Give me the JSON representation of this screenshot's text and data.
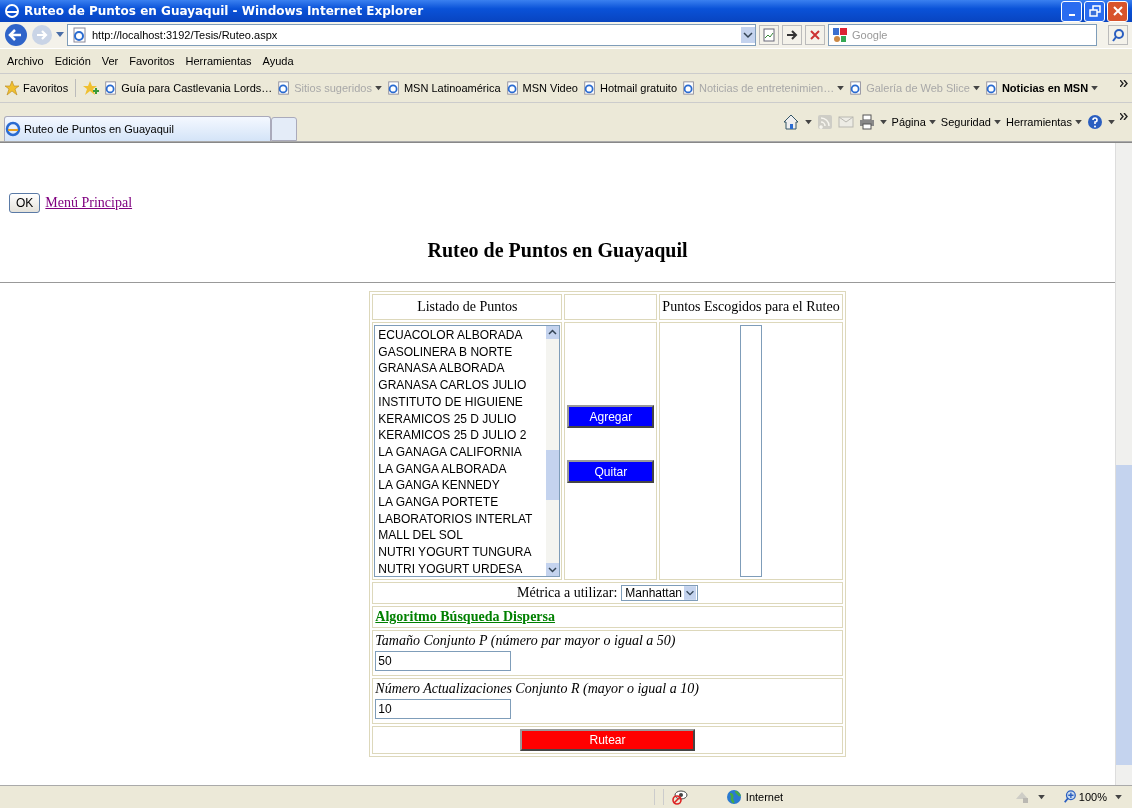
{
  "window": {
    "title": "Ruteo de Puntos en Guayaquil - Windows Internet Explorer"
  },
  "address_bar": {
    "url": "http://localhost:3192/Tesis/Ruteo.aspx"
  },
  "search_field": {
    "placeholder": "Google"
  },
  "menu": [
    "Archivo",
    "Edición",
    "Ver",
    "Favoritos",
    "Herramientas",
    "Ayuda"
  ],
  "favorites_bar": {
    "label": "Favoritos",
    "items": [
      {
        "label": "Guía para Castlevania Lords…",
        "dropdown": false,
        "disabled": false,
        "bold": false
      },
      {
        "label": "Sitios sugeridos",
        "dropdown": true,
        "disabled": true,
        "bold": false
      },
      {
        "label": "MSN Latinoamérica",
        "dropdown": false,
        "disabled": false,
        "bold": false
      },
      {
        "label": "MSN Video",
        "dropdown": false,
        "disabled": false,
        "bold": false
      },
      {
        "label": "Hotmail gratuito",
        "dropdown": false,
        "disabled": false,
        "bold": false
      },
      {
        "label": "Noticias de entretenimien…",
        "dropdown": true,
        "disabled": true,
        "bold": false
      },
      {
        "label": "Galería de Web Slice",
        "dropdown": true,
        "disabled": true,
        "bold": false
      },
      {
        "label": "Noticias en MSN",
        "dropdown": true,
        "disabled": false,
        "bold": true
      }
    ]
  },
  "tabs": [
    {
      "label": "Ruteo de Puntos en Guayaquil",
      "selected": true
    }
  ],
  "command_bar": [
    "Página",
    "Seguridad",
    "Herramientas"
  ],
  "page": {
    "ok_button": "OK",
    "main_menu_link": "Menú Principal",
    "heading": "Ruteo de Puntos en Guayaquil",
    "points_header": "Listado de Puntos",
    "chosen_header": "Puntos Escogidos para el Ruteo",
    "points": [
      "ECUACOLOR ALBORADA",
      "GASOLINERA B NORTE",
      "GRANASA ALBORADA",
      "GRANASA CARLOS JULIO",
      "INSTITUTO DE HIGUIENE",
      "KERAMICOS 25 D JULIO",
      "KERAMICOS 25 D JULIO 2",
      "LA GANAGA CALIFORNIA",
      "LA GANGA ALBORADA",
      "LA GANGA KENNEDY",
      "LA GANGA PORTETE",
      "LABORATORIOS INTERLAT",
      "MALL DEL SOL",
      "NUTRI YOGURT TUNGURA",
      "NUTRI YOGURT URDESA"
    ],
    "add_button": "Agregar",
    "remove_button": "Quitar",
    "metric_label": "Métrica a utilizar:",
    "metric_value": "Manhattan",
    "algorithm_link": "Algoritmo Búsqueda Dispersa",
    "fields": [
      {
        "label": "Tamaño Conjunto P (número par mayor o igual a 50)",
        "value": "50"
      },
      {
        "label": "Número Actualizaciones Conjunto R (mayor o igual a 10)",
        "value": "10"
      }
    ],
    "route_button": "Rutear"
  },
  "status_bar": {
    "zone": "Internet",
    "zoom": "100%"
  }
}
